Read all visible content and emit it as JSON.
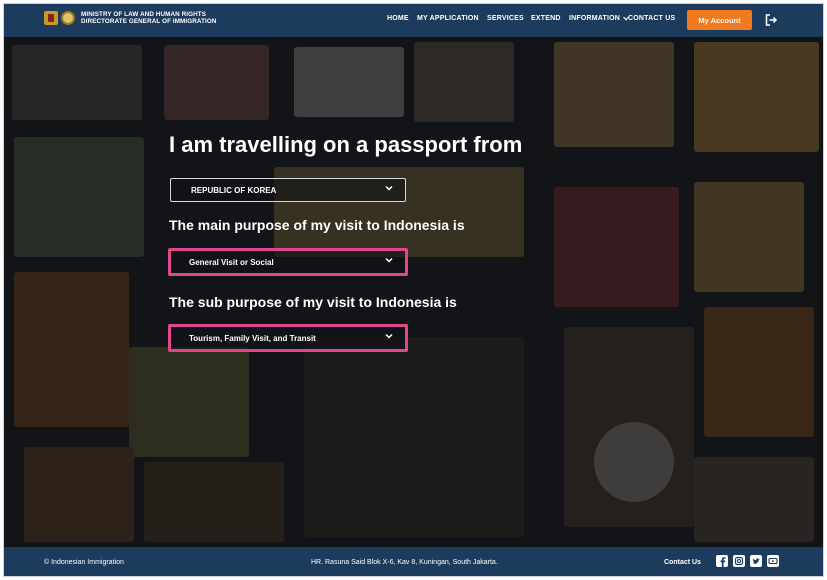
{
  "header": {
    "brand_line1": "MINISTRY OF LAW AND HUMAN RIGHTS",
    "brand_line2": "DIRECTORATE GENERAL OF IMMIGRATION",
    "nav": {
      "home": "HOME",
      "my_application": "MY APPLICATION",
      "services": "SERVICES",
      "extend": "EXTEND",
      "information": "INFORMATION",
      "contact_us": "CONTACT US"
    },
    "account_button": "My Account"
  },
  "form": {
    "title": "I am travelling on a passport from",
    "passport_country": "REPUBLIC OF KOREA",
    "purpose_label": "The main purpose of my visit to Indonesia is",
    "purpose_value": "General Visit or Social",
    "sub_purpose_label": "The sub purpose of my visit to Indonesia is",
    "sub_purpose_value": "Tourism, Family Visit, and Transit"
  },
  "footer": {
    "copyright": "© Indonesian Immigration",
    "address": "HR. Rasuna Said Blok X-6, Kav 8, Kuningan, South Jakarta.",
    "contact": "Contact Us"
  },
  "colors": {
    "header_bg": "#1d3b5c",
    "accent_orange": "#ef7a22",
    "highlight_pink": "#e0458d"
  },
  "icons": {
    "logout": "logout-icon",
    "chevron": "chevron-down-icon",
    "social": [
      "facebook-icon",
      "instagram-icon",
      "twitter-icon",
      "youtube-icon"
    ]
  }
}
